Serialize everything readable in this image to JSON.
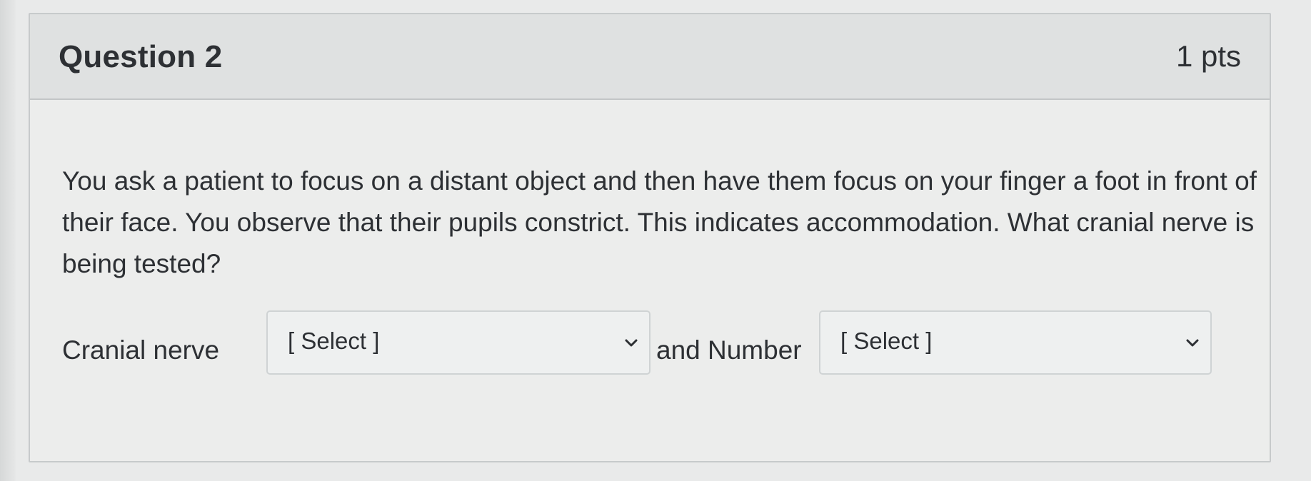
{
  "question": {
    "title": "Question 2",
    "points": "1 pts",
    "text": "You ask a patient to focus on a distant object and then have them focus on your finger a foot in front of their face. You observe that their pupils constrict.  This indicates accommodation. What cranial nerve is being tested?"
  },
  "answer": {
    "cranial_nerve_label": "Cranial nerve",
    "cranial_nerve_select": "[ Select ]",
    "number_label": "and Number",
    "number_select": "[ Select ]"
  },
  "icons": {
    "dropdown": "chevron-down-icon"
  },
  "colors": {
    "background": "#e9eaea",
    "card": "#ecedec",
    "header": "#dfe1e1",
    "border": "#c7cacb",
    "text": "#2d3034"
  }
}
